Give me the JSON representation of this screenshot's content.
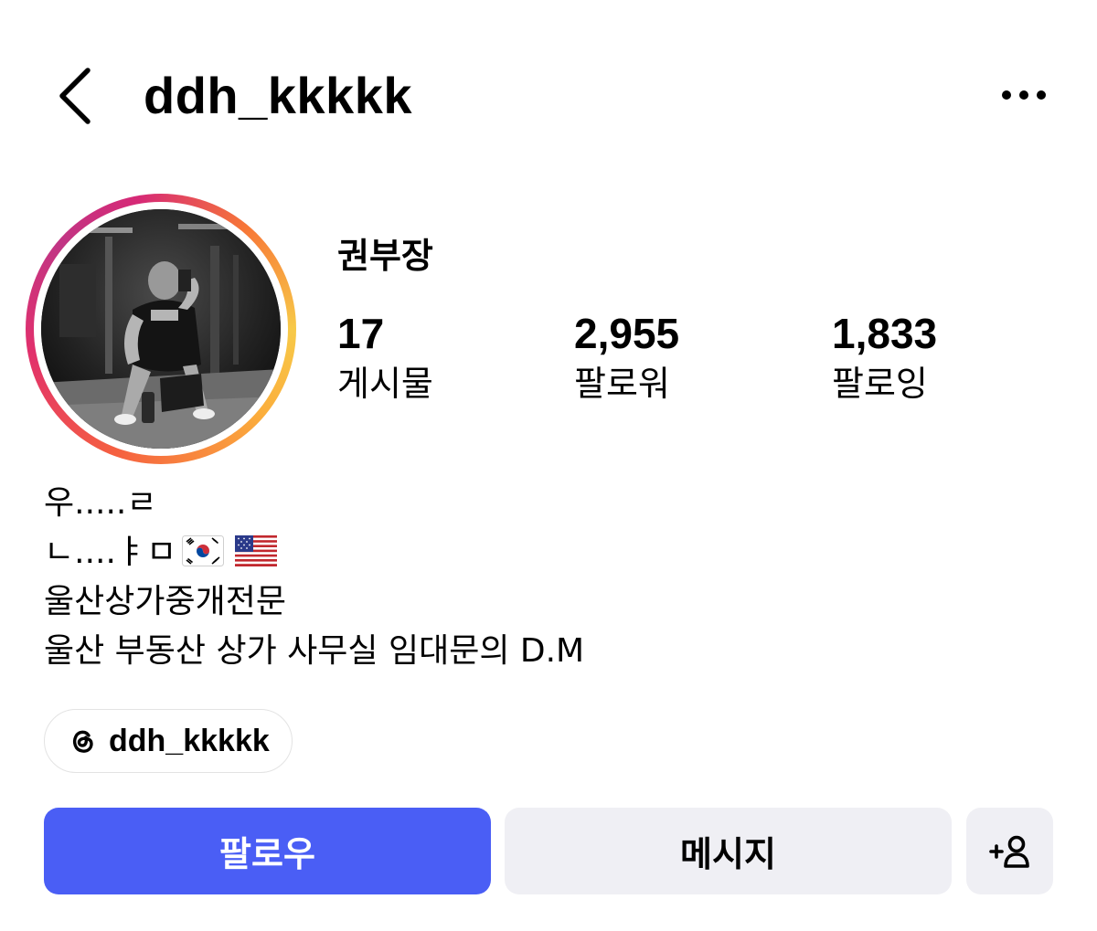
{
  "header": {
    "username": "ddh_kkkkk",
    "back_icon": "chevron-left-icon",
    "more_icon": "more-horizontal-icon"
  },
  "profile": {
    "display_name": "권부장",
    "avatar_ring_colors": [
      "#f7c948",
      "#f56040",
      "#e1306c",
      "#c13584"
    ]
  },
  "stats": [
    {
      "value": "17",
      "label": "게시물"
    },
    {
      "value": "2,955",
      "label": "팔로워"
    },
    {
      "value": "1,833",
      "label": "팔로잉"
    }
  ],
  "bio": {
    "line1": "우.....ㄹ",
    "line2": "ㄴ....ㅑㅁ",
    "line2_emojis": [
      "korea-flag",
      "usa-flag"
    ],
    "line3": "울산상가중개전문",
    "line4": "울산 부동산 상가 사무실 임대문의 D.M"
  },
  "threads": {
    "icon": "threads-icon",
    "handle": "ddh_kkkkk"
  },
  "buttons": {
    "follow_label": "팔로우",
    "follow_color": "#4a5ef5",
    "message_label": "메시지",
    "add_user_icon": "add-user-icon"
  }
}
